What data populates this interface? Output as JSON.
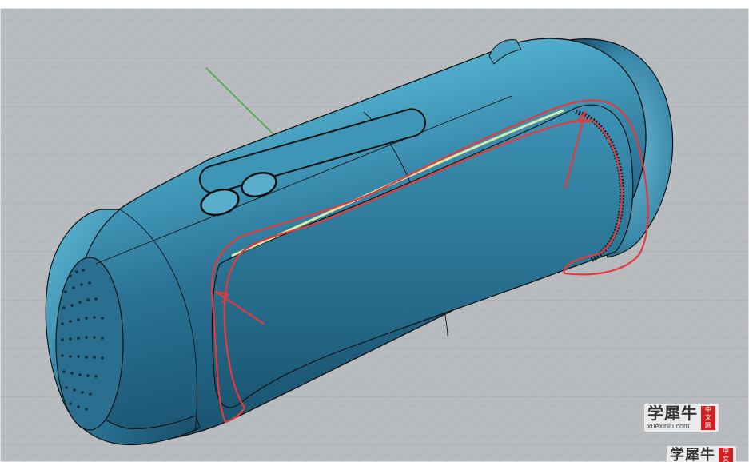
{
  "watermark": {
    "chinese_name": "学犀牛",
    "url": "xuexiniu.com",
    "seal_line1": "中",
    "seal_line2": "文",
    "seal_line3": "网"
  },
  "colors": {
    "background": "#ffffff",
    "viewport_floor": "#b7babd",
    "grid_line": "#a3a6aa",
    "grid_major": "#9a9da1",
    "y_axis": "#3aa83a",
    "model_body": "#2f7fa3",
    "model_highlight": "#8fd6e6",
    "model_shadow": "#16506b",
    "edge": "#111111",
    "annotation": "#e63a3a",
    "watermark_seal": "#d01f25"
  },
  "icons": {
    "viewport_model": "bluetooth-speaker-model-icon",
    "annotation": "red-freehand-annotation-icon"
  }
}
